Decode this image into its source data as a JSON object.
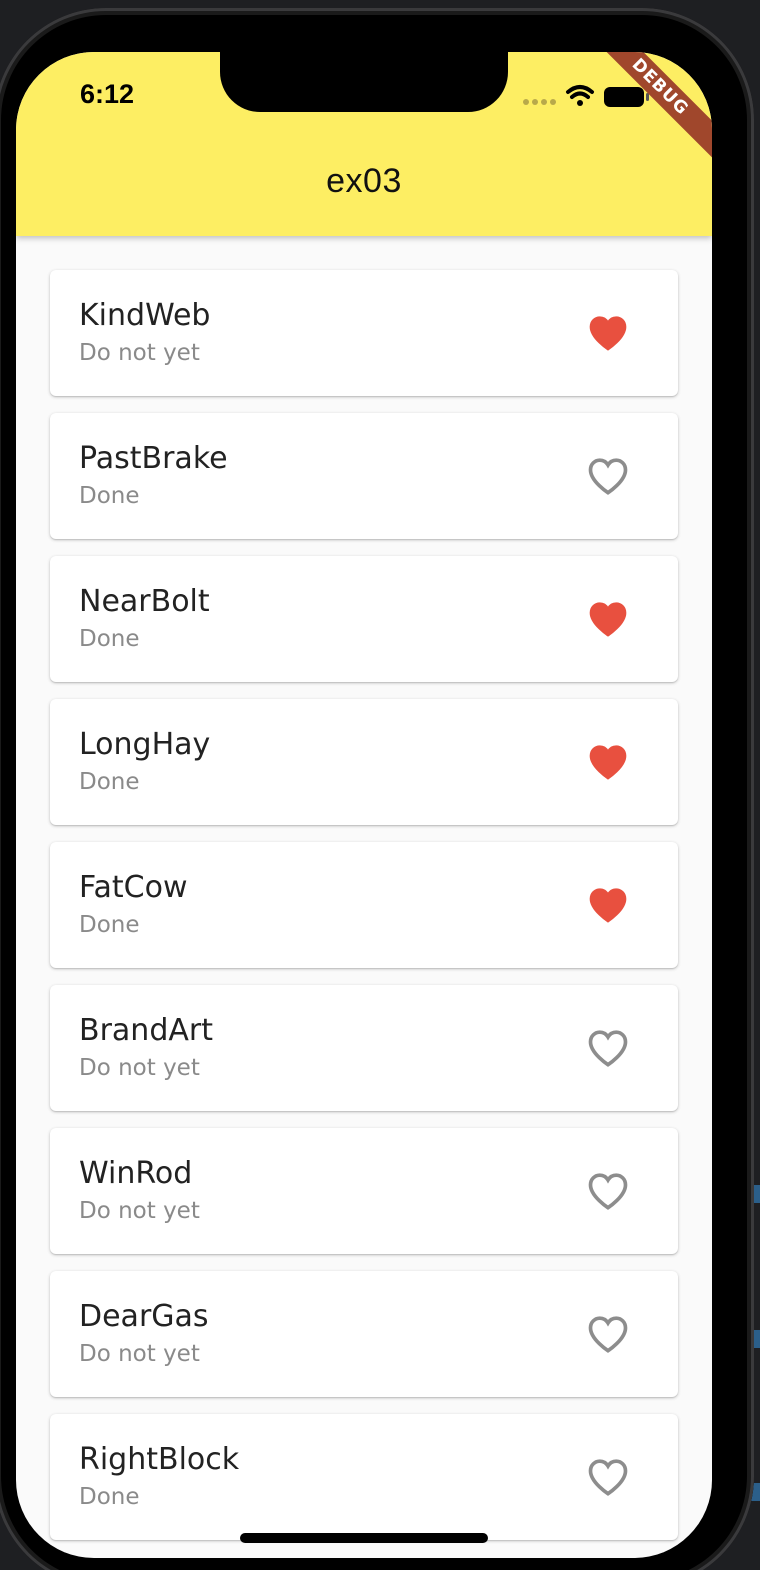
{
  "status_bar": {
    "time": "6:12",
    "icons": [
      "signal-dots-icon",
      "wifi-icon",
      "battery-icon"
    ]
  },
  "debug_banner": {
    "label": "DEBUG",
    "color": "#a0472c"
  },
  "app_bar": {
    "title": "ex03",
    "color": "#fdee63"
  },
  "colors": {
    "favorite_on": "#e8503f",
    "favorite_off": "#8d8d8d"
  },
  "items": [
    {
      "title": "KindWeb",
      "subtitle": "Do not yet",
      "favorite": true
    },
    {
      "title": "PastBrake",
      "subtitle": "Done",
      "favorite": false
    },
    {
      "title": "NearBolt",
      "subtitle": "Done",
      "favorite": true
    },
    {
      "title": "LongHay",
      "subtitle": "Done",
      "favorite": true
    },
    {
      "title": "FatCow",
      "subtitle": "Done",
      "favorite": true
    },
    {
      "title": "BrandArt",
      "subtitle": "Do not yet",
      "favorite": false
    },
    {
      "title": "WinRod",
      "subtitle": "Do not yet",
      "favorite": false
    },
    {
      "title": "DearGas",
      "subtitle": "Do not yet",
      "favorite": false
    },
    {
      "title": "RightBlock",
      "subtitle": "Done",
      "favorite": false
    }
  ]
}
